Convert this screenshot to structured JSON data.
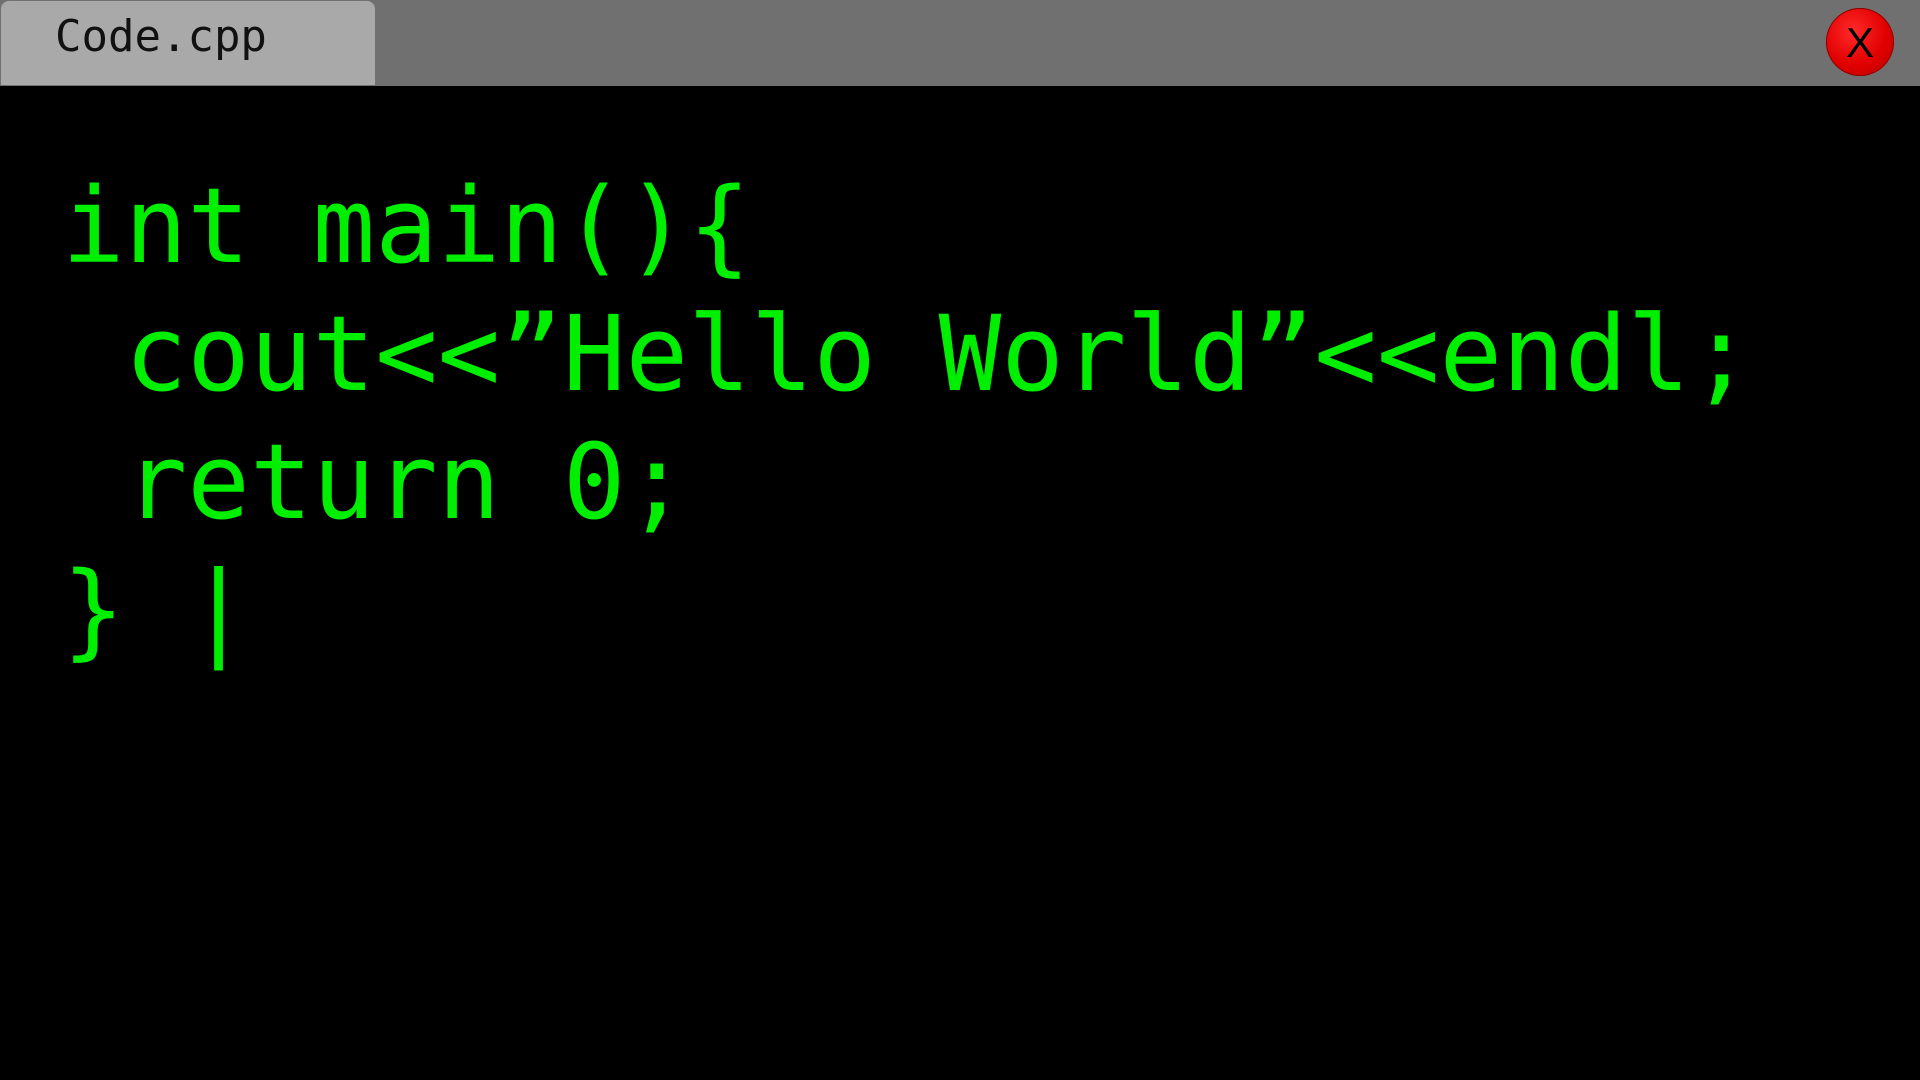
{
  "tab": {
    "label": "Code.cpp"
  },
  "close_button": {
    "label": "X",
    "icon": "close-icon"
  },
  "editor": {
    "lines": [
      "int main(){",
      " cout<<”Hello World”<<endl;",
      " return 0;",
      "} |"
    ],
    "text_color": "#00ee00",
    "background_color": "#000000"
  },
  "colors": {
    "titlebar": "#707070",
    "tab": "#a9a9a9",
    "close_button": "#e10000"
  }
}
